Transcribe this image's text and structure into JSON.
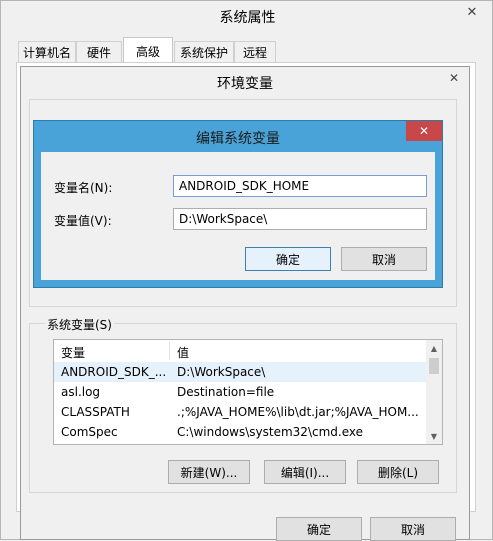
{
  "system_properties": {
    "title": "系统属性",
    "tabs": [
      {
        "label": "计算机名"
      },
      {
        "label": "硬件"
      },
      {
        "label": "高级"
      },
      {
        "label": "系统保护"
      },
      {
        "label": "远程"
      }
    ],
    "ok_label": "确定",
    "cancel_label": "取消"
  },
  "env_vars": {
    "title": "环境变量",
    "system_vars_label": "系统变量(S)",
    "columns": [
      "变量",
      "值"
    ],
    "rows": [
      {
        "name": "ANDROID_SDK_...",
        "value": "D:\\WorkSpace\\"
      },
      {
        "name": "asl.log",
        "value": "Destination=file"
      },
      {
        "name": "CLASSPATH",
        "value": ".;%JAVA_HOME%\\lib\\dt.jar;%JAVA_HOM..."
      },
      {
        "name": "ComSpec",
        "value": "C:\\windows\\system32\\cmd.exe"
      }
    ],
    "new_label": "新建(W)...",
    "edit_label": "编辑(I)...",
    "delete_label": "删除(L)"
  },
  "edit_dialog": {
    "title": "编辑系统变量",
    "name_label": "变量名(N):",
    "name_value": "ANDROID_SDK_HOME",
    "value_label": "变量值(V):",
    "value_value": "D:\\WorkSpace\\",
    "ok_label": "确定",
    "cancel_label": "取消"
  },
  "colors": {
    "accent_border": "#2b7ca6",
    "title_bar": "#4aa3d8",
    "close_red": "#c7474a",
    "selection": "#e5f1fb"
  }
}
